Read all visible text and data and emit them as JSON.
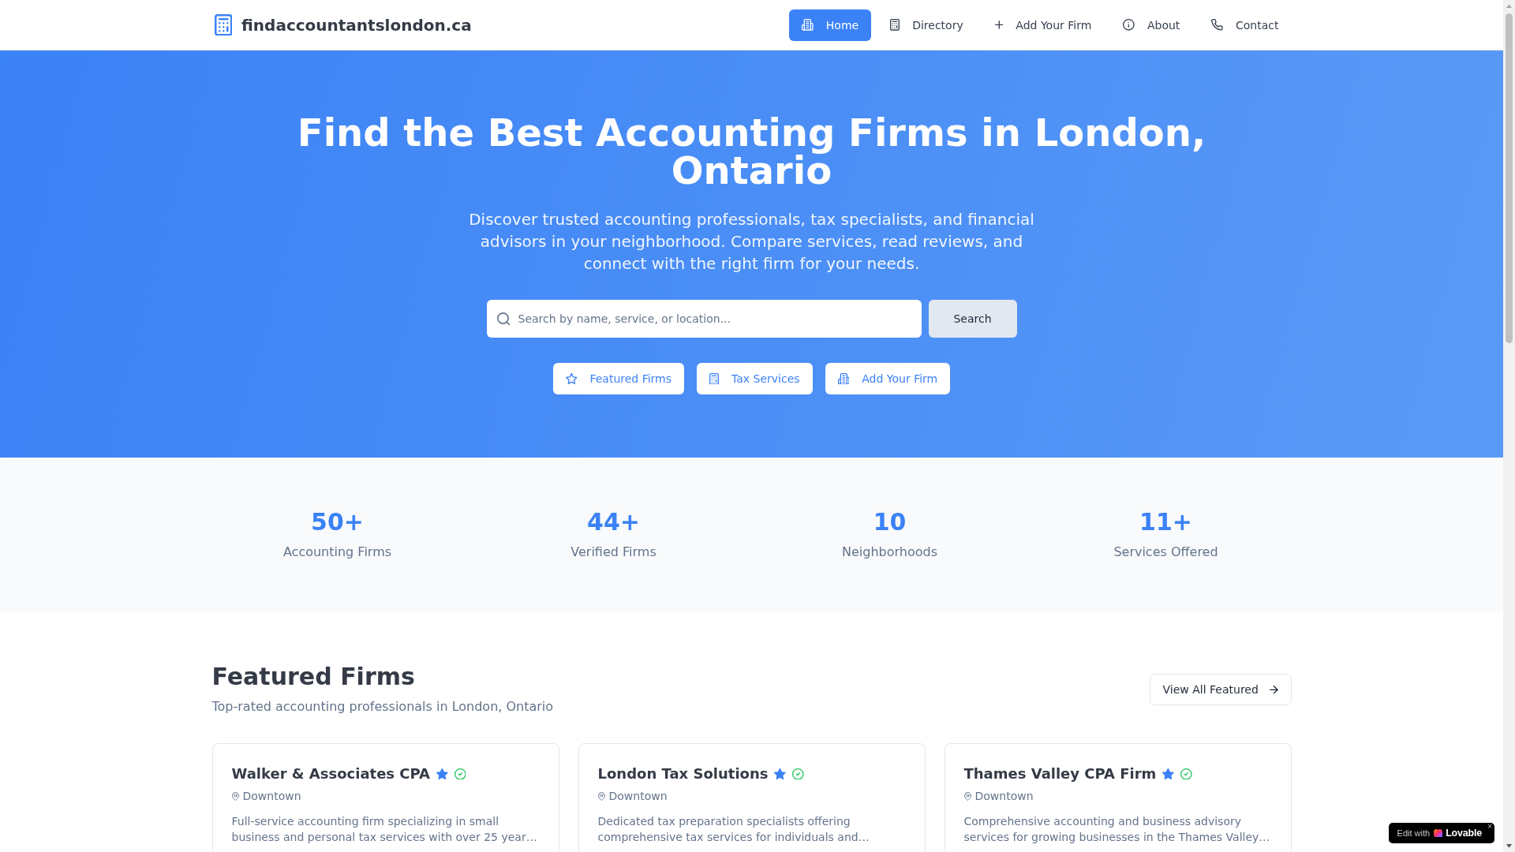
{
  "navbar": {
    "brand": "findaccountantslondon.ca",
    "items": [
      {
        "label": "Home",
        "selected": true
      },
      {
        "label": "Directory",
        "selected": false
      },
      {
        "label": "Add Your Firm",
        "selected": false
      },
      {
        "label": "About",
        "selected": false
      },
      {
        "label": "Contact",
        "selected": false
      }
    ]
  },
  "hero": {
    "title": "Find the Best Accounting Firms in London, Ontario",
    "subtitle": "Discover trusted accounting professionals, tax specialists, and financial advisors in your neighborhood. Compare services, read reviews, and connect with the right firm for your needs.",
    "search": {
      "placeholder": "Search by name, service, or location...",
      "button": "Search"
    },
    "quick_links": [
      "Featured Firms",
      "Tax Services",
      "Add Your Firm"
    ]
  },
  "stats": [
    {
      "value": "50+",
      "label": "Accounting Firms"
    },
    {
      "value": "44+",
      "label": "Verified Firms"
    },
    {
      "value": "10",
      "label": "Neighborhoods"
    },
    {
      "value": "11+",
      "label": "Services Offered"
    }
  ],
  "featured": {
    "title": "Featured Firms",
    "subtitle": "Top-rated accounting professionals in London, Ontario",
    "view_all": "View All Featured",
    "firms": [
      {
        "name": "Walker & Associates CPA",
        "featured": true,
        "verified": true,
        "location": "Downtown",
        "description": "Full-service accounting firm specializing in small business and personal tax services with over 25 year…"
      },
      {
        "name": "London Tax Solutions",
        "featured": true,
        "verified": true,
        "location": "Downtown",
        "description": "Dedicated tax preparation specialists offering comprehensive tax services for individuals and…"
      },
      {
        "name": "Thames Valley CPA Firm",
        "featured": true,
        "verified": true,
        "location": "Downtown",
        "description": "Comprehensive accounting and business advisory services for growing businesses in the Thames Valley…"
      }
    ]
  },
  "edit_badge": {
    "text": "Edit with",
    "brand": "Lovable",
    "close": "×"
  }
}
